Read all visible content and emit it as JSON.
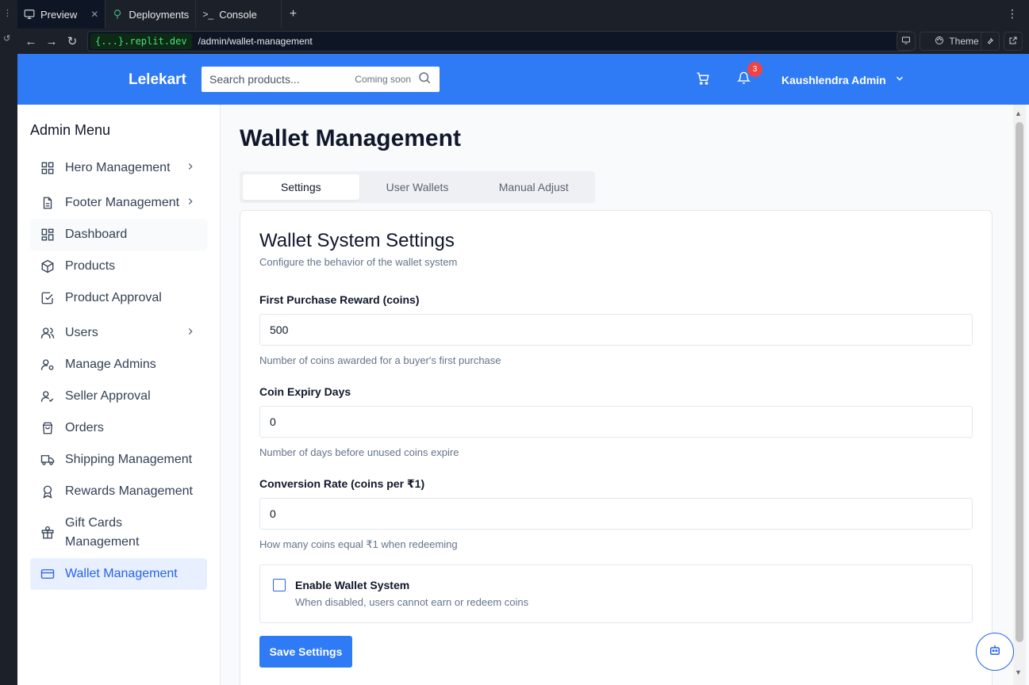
{
  "chrome": {
    "tabs": [
      {
        "label": "Preview",
        "icon": "monitor-icon"
      },
      {
        "label": "Deployments",
        "icon": "deploy-icon"
      },
      {
        "label": "Console",
        "icon": "terminal-icon"
      }
    ],
    "url_domain": "{...}.replit.dev",
    "url_path": "/admin/wallet-management",
    "theme_label": "Theme"
  },
  "header": {
    "logo": "Lelekart",
    "search_placeholder": "Search products...",
    "search_note": "Coming soon",
    "notification_count": "3",
    "user_name": "Kaushlendra Admin"
  },
  "sidebar": {
    "title": "Admin Menu",
    "items": [
      {
        "label": "Hero Management",
        "icon": "grid-icon",
        "expandable": true
      },
      {
        "label": "Footer Management",
        "icon": "file-text-icon",
        "expandable": true
      },
      {
        "label": "Dashboard",
        "icon": "dashboard-icon"
      },
      {
        "label": "Products",
        "icon": "package-icon"
      },
      {
        "label": "Product Approval",
        "icon": "check-square-icon"
      },
      {
        "label": "Users",
        "icon": "users-icon",
        "expandable": true
      },
      {
        "label": "Manage Admins",
        "icon": "user-cog-icon"
      },
      {
        "label": "Seller Approval",
        "icon": "user-check-icon"
      },
      {
        "label": "Orders",
        "icon": "shopping-bag-icon"
      },
      {
        "label": "Shipping Management",
        "icon": "truck-icon"
      },
      {
        "label": "Rewards Management",
        "icon": "award-icon"
      },
      {
        "label": "Gift Cards Management",
        "icon": "gift-icon"
      },
      {
        "label": "Wallet Management",
        "icon": "credit-card-icon",
        "active": true
      }
    ]
  },
  "page": {
    "title": "Wallet Management",
    "tabs": [
      "Settings",
      "User Wallets",
      "Manual Adjust"
    ],
    "active_tab": "Settings",
    "card_title": "Wallet System Settings",
    "card_desc": "Configure the behavior of the wallet system",
    "fields": [
      {
        "label": "First Purchase Reward (coins)",
        "value": "500",
        "hint": "Number of coins awarded for a buyer's first purchase"
      },
      {
        "label": "Coin Expiry Days",
        "value": "0",
        "hint": "Number of days before unused coins expire"
      },
      {
        "label": "Conversion Rate (coins per ₹1)",
        "value": "0",
        "hint": "How many coins equal ₹1 when redeeming"
      }
    ],
    "toggle_label": "Enable Wallet System",
    "toggle_desc": "When disabled, users cannot earn or redeem coins",
    "toggle_checked": false,
    "save_label": "Save Settings"
  },
  "colors": {
    "brand": "#2f7bf5",
    "active_bg": "#e8effe",
    "badge": "#ef4444"
  }
}
